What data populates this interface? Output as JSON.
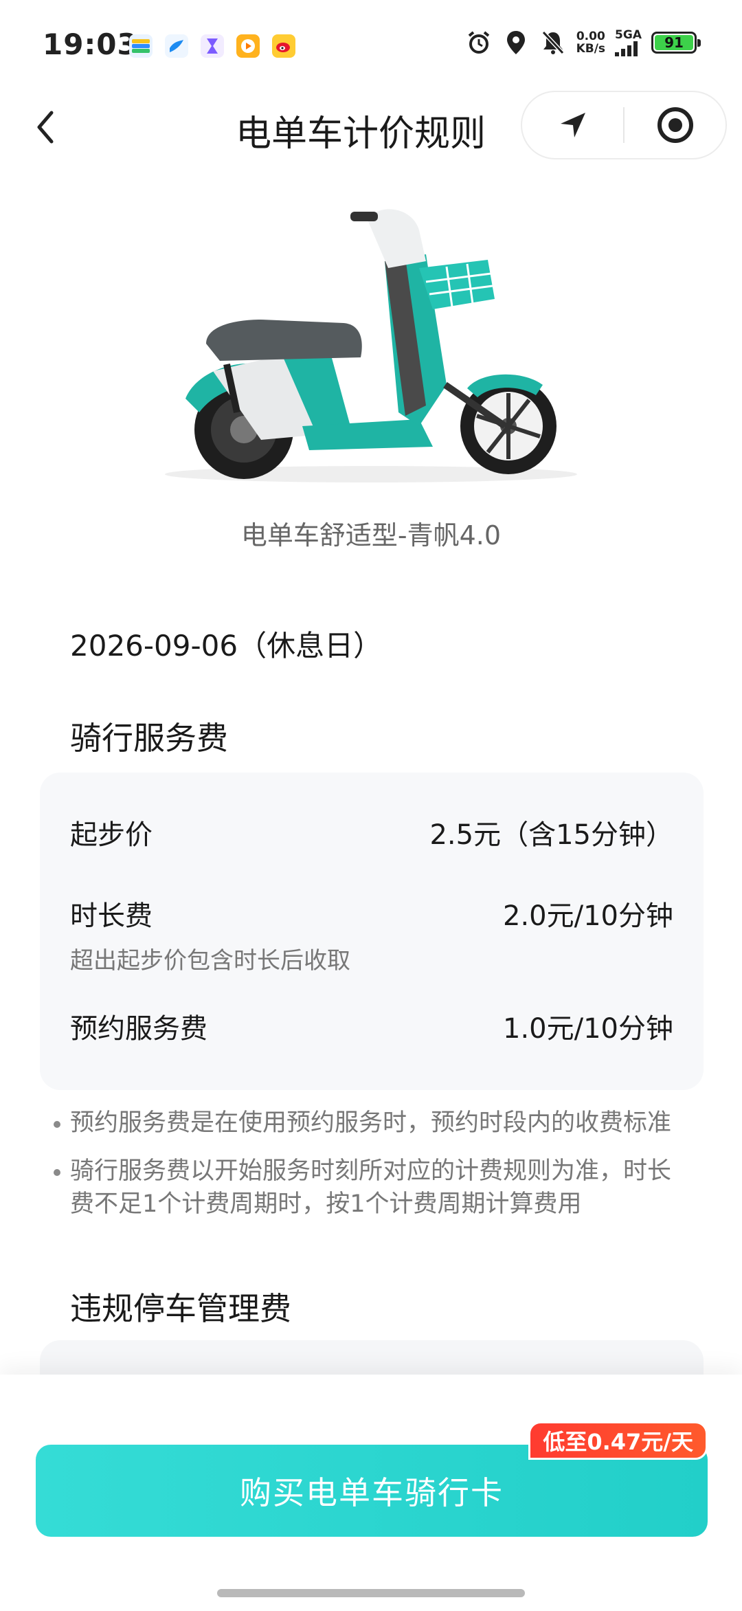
{
  "status_bar": {
    "time": "19:03",
    "net_speed_value": "0.00",
    "net_speed_unit": "KB/s",
    "signal_label": "5GA",
    "battery": "91"
  },
  "nav": {
    "title": "电单车计价规则"
  },
  "vehicle": {
    "name": "电单车舒适型-青帆4.0"
  },
  "date": "2026-09-06（休息日）",
  "riding_fee": {
    "title": "骑行服务费",
    "start_price_label": "起步价",
    "start_price_value": "2.5元（含15分钟）",
    "duration_fee_label": "时长费",
    "duration_fee_value": "2.0元/10分钟",
    "duration_fee_note": "超出起步价包含时长后收取",
    "reservation_fee_label": "预约服务费",
    "reservation_fee_value": "1.0元/10分钟"
  },
  "notes": [
    "预约服务费是在使用预约服务时，预约时段内的收费标准",
    "骑行服务费以开始服务时刻所对应的计费规则为准，时长费不足1个计费周期时，按1个计费周期计算费用"
  ],
  "violation": {
    "title": "违规停车管理费"
  },
  "bottom": {
    "buy_label": "购买电单车骑行卡",
    "promo": "低至0.47元/天"
  },
  "colors": {
    "accent": "#22cfc9",
    "promo": "#ff3b30"
  }
}
